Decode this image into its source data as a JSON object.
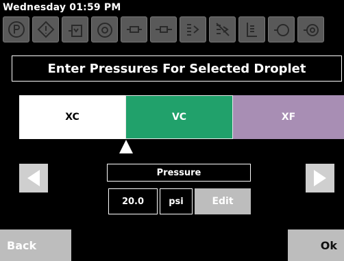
{
  "status": {
    "time": "Wednesday 01:59 PM"
  },
  "toolbar": {
    "icons": [
      "parking-icon",
      "warning-icon",
      "tank-icon",
      "pump-icon",
      "nozzle-icon",
      "boom-icon",
      "spray-pattern-icon",
      "crossed-spray-icon",
      "flow-gauge-icon",
      "valve-icon",
      "settings-valve-icon"
    ]
  },
  "header": {
    "title": "Enter Pressures For Selected Droplet"
  },
  "droplets": {
    "tabs": [
      {
        "label": "XC",
        "color": "#ffffff"
      },
      {
        "label": "VC",
        "color": "#21a16b"
      },
      {
        "label": "XF",
        "color": "#a88eb4"
      }
    ],
    "selected": "VC"
  },
  "pressure": {
    "label": "Pressure",
    "value": "20.0",
    "unit": "psi",
    "edit_label": "Edit"
  },
  "footer": {
    "back_label": "Back",
    "ok_label": "Ok"
  }
}
